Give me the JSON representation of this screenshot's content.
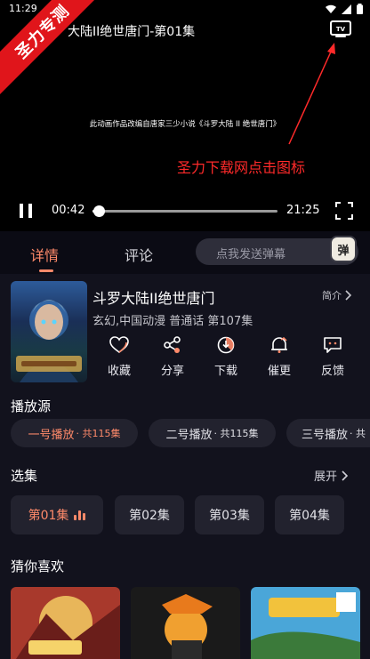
{
  "status_bar": {
    "time": "11:29"
  },
  "watermark": {
    "text": "圣力专测"
  },
  "player": {
    "title": "大陆II绝世唐门-第01集",
    "subtitle": "此动画作品改编自唐家三少小说《斗罗大陆 II 绝世唐门》",
    "annotation": "圣力下载网点击图标",
    "current_time": "00:42",
    "total_time": "21:25",
    "progress": 0.033,
    "icons": [
      "tv-cast-icon",
      "pause-icon",
      "fullscreen-icon"
    ]
  },
  "tabs": [
    {
      "label": "详情",
      "active": true
    },
    {
      "label": "评论",
      "active": false
    }
  ],
  "danmaku": {
    "placeholder": "点我发送弹幕",
    "icon_label": "弹"
  },
  "show": {
    "title": "斗罗大陆II绝世唐门",
    "meta": "玄幻,中国动漫 普通话 第107集",
    "intro_label": "简介"
  },
  "actions": [
    {
      "label": "收藏",
      "icon": "heart-icon"
    },
    {
      "label": "分享",
      "icon": "share-icon"
    },
    {
      "label": "下载",
      "icon": "download-icon"
    },
    {
      "label": "催更",
      "icon": "remind-icon"
    },
    {
      "label": "反馈",
      "icon": "feedback-icon"
    }
  ],
  "sources": {
    "title": "播放源",
    "items": [
      {
        "name": "一号播放",
        "count": "· 共115集",
        "active": true
      },
      {
        "name": "二号播放",
        "count": "· 共115集",
        "active": false
      },
      {
        "name": "三号播放",
        "count": "· 共",
        "active": false
      }
    ]
  },
  "episodes": {
    "title": "选集",
    "expand_label": "展开",
    "items": [
      {
        "label": "第01集",
        "active": true
      },
      {
        "label": "第02集",
        "active": false
      },
      {
        "label": "第03集",
        "active": false
      },
      {
        "label": "第04集",
        "active": false
      }
    ]
  },
  "recommendations": {
    "title": "猜你喜欢"
  },
  "colors": {
    "accent": "#ff8a6a",
    "ribbon": "#e0151b",
    "annotation": "#ff2a2a",
    "background": "#12121d"
  }
}
